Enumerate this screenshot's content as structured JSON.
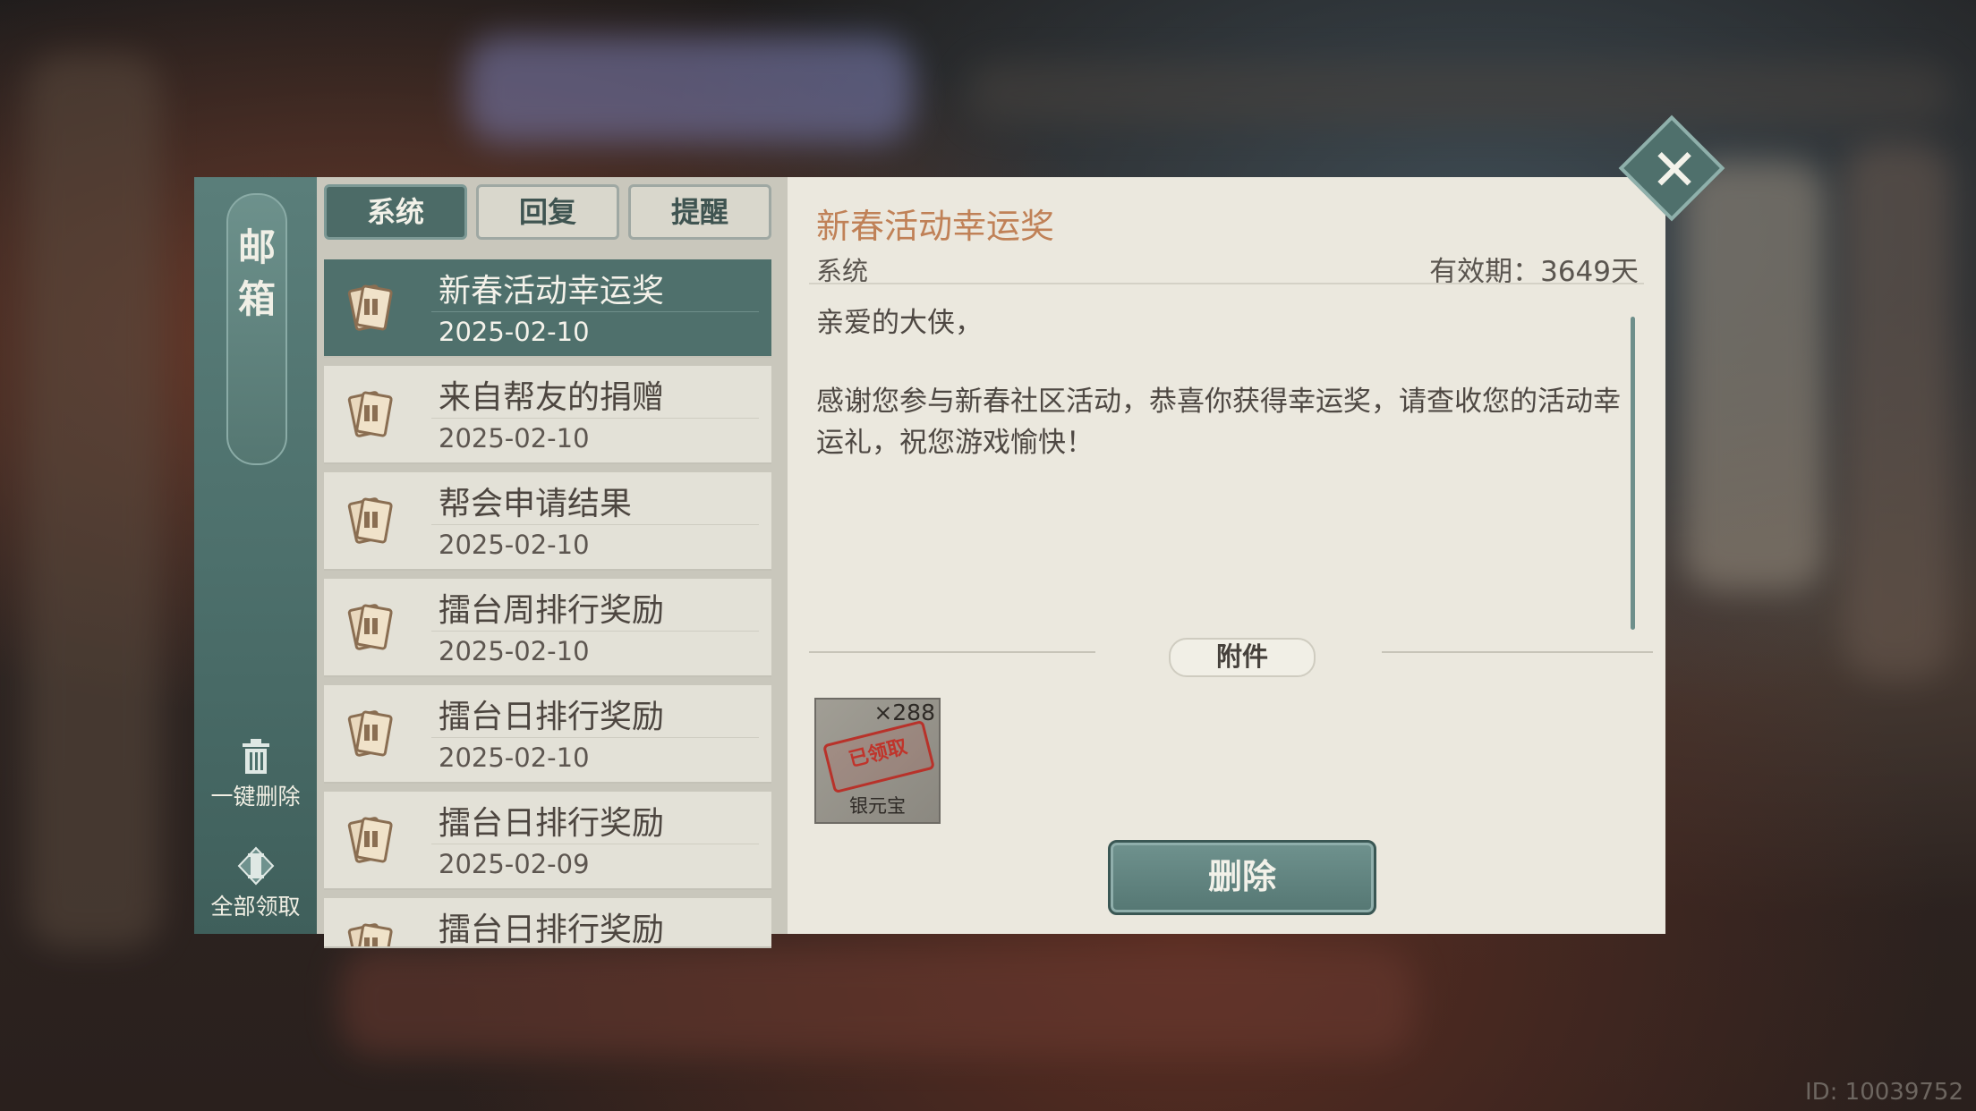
{
  "mailbox": {
    "title_chars": [
      "邮",
      "箱"
    ],
    "delete_all_label": "一键删除",
    "claim_all_label": "全部领取"
  },
  "tabs": [
    {
      "label": "系统",
      "active": true
    },
    {
      "label": "回复",
      "active": false
    },
    {
      "label": "提醒",
      "active": false
    }
  ],
  "mails": [
    {
      "title": "新春活动幸运奖",
      "date": "2025-02-10",
      "selected": true
    },
    {
      "title": "来自帮友的捐赠",
      "date": "2025-02-10",
      "selected": false
    },
    {
      "title": "帮会申请结果",
      "date": "2025-02-10",
      "selected": false
    },
    {
      "title": "擂台周排行奖励",
      "date": "2025-02-10",
      "selected": false
    },
    {
      "title": "擂台日排行奖励",
      "date": "2025-02-10",
      "selected": false
    },
    {
      "title": "擂台日排行奖励",
      "date": "2025-02-09",
      "selected": false
    },
    {
      "title": "擂台日排行奖励",
      "date": "",
      "selected": false
    }
  ],
  "detail": {
    "title": "新春活动幸运奖",
    "sender": "系统",
    "validity": "有效期：3649天",
    "greeting": "亲爱的大侠，",
    "body": "感谢您参与新春社区活动，恭喜你获得幸运奖，请查收您的活动幸运礼，祝您游戏愉快！",
    "attachment_label": "附件",
    "attachment": {
      "name": "银元宝",
      "count": "×288",
      "status": "已领取"
    },
    "delete_label": "删除"
  },
  "close_icon": "close-x-icon",
  "footer_id": "ID: 10039752",
  "colors": {
    "accent_teal": "#4f706c",
    "title_orange": "#c08157",
    "stamp_red": "#c0342b"
  }
}
